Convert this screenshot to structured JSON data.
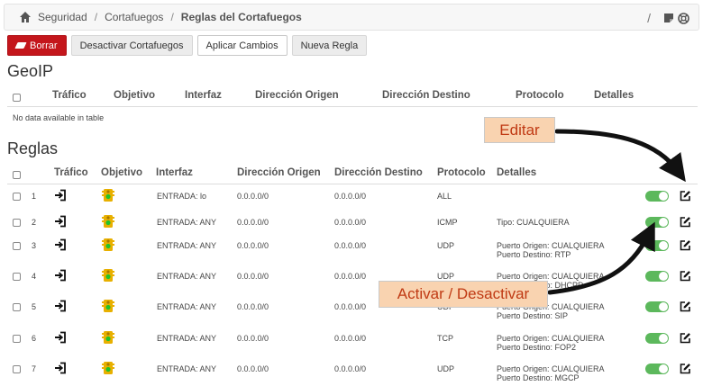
{
  "breadcrumb": {
    "item1": "Seguridad",
    "item2": "Cortafuegos",
    "current": "Reglas del Cortafuegos",
    "separator": "/"
  },
  "toolbar": {
    "delete": "Borrar",
    "deactivate": "Desactivar Cortafuegos",
    "apply": "Aplicar Cambios",
    "new_rule": "Nueva Regla"
  },
  "geoip": {
    "title": "GeoIP",
    "columns": [
      "Tráfico",
      "Objetivo",
      "Interfaz",
      "Dirección Origen",
      "Dirección Destino",
      "Protocolo",
      "Detalles"
    ],
    "empty": "No data available in table"
  },
  "rules": {
    "title": "Reglas",
    "columns": [
      "Tráfico",
      "Objetivo",
      "Interfaz",
      "Dirección Origen",
      "Dirección Destino",
      "Protocolo",
      "Detalles"
    ],
    "rows": [
      {
        "num": "1",
        "iface": "ENTRADA: lo",
        "src": "0.0.0.0/0",
        "dst": "0.0.0.0/0",
        "proto": "ALL",
        "det1": "",
        "det2": "",
        "enabled": true
      },
      {
        "num": "2",
        "iface": "ENTRADA: ANY",
        "src": "0.0.0.0/0",
        "dst": "0.0.0.0/0",
        "proto": "ICMP",
        "det1": "Tipo: CUALQUIERA",
        "det2": "",
        "enabled": true
      },
      {
        "num": "3",
        "iface": "ENTRADA: ANY",
        "src": "0.0.0.0/0",
        "dst": "0.0.0.0/0",
        "proto": "UDP",
        "det1": "Puerto Origen: CUALQUIERA",
        "det2": "Puerto Destino: RTP",
        "enabled": true
      },
      {
        "num": "4",
        "iface": "ENTRADA: ANY",
        "src": "0.0.0.0/0",
        "dst": "0.0.0.0/0",
        "proto": "UDP",
        "det1": "Puerto Origen: CUALQUIERA",
        "det2": "Puerto Destino: DHCPD",
        "enabled": true
      },
      {
        "num": "5",
        "iface": "ENTRADA: ANY",
        "src": "0.0.0.0/0",
        "dst": "0.0.0.0/0",
        "proto": "UDP",
        "det1": "Puerto Origen: CUALQUIERA",
        "det2": "Puerto Destino: SIP",
        "enabled": true
      },
      {
        "num": "6",
        "iface": "ENTRADA: ANY",
        "src": "0.0.0.0/0",
        "dst": "0.0.0.0/0",
        "proto": "TCP",
        "det1": "Puerto Origen: CUALQUIERA",
        "det2": "Puerto Destino: FOP2",
        "enabled": true
      },
      {
        "num": "7",
        "iface": "ENTRADA: ANY",
        "src": "0.0.0.0/0",
        "dst": "0.0.0.0/0",
        "proto": "UDP",
        "det1": "Puerto Origen: CUALQUIERA",
        "det2": "Puerto Destino: MGCP",
        "enabled": true
      }
    ]
  },
  "annotations": {
    "edit": "Editar",
    "toggle": "Activar / Desactivar"
  },
  "colors": {
    "danger": "#c4161c",
    "toggle_on": "#5cb85c",
    "callout_bg": "#f9d3b0",
    "callout_text": "#c03a14"
  },
  "icons": {
    "home": "home-icon",
    "traffic": "sign-in-icon",
    "target": "traffic-light-icon",
    "edit": "edit-icon",
    "sticky": "sticky-note-icon",
    "help": "lifebuoy-icon"
  }
}
